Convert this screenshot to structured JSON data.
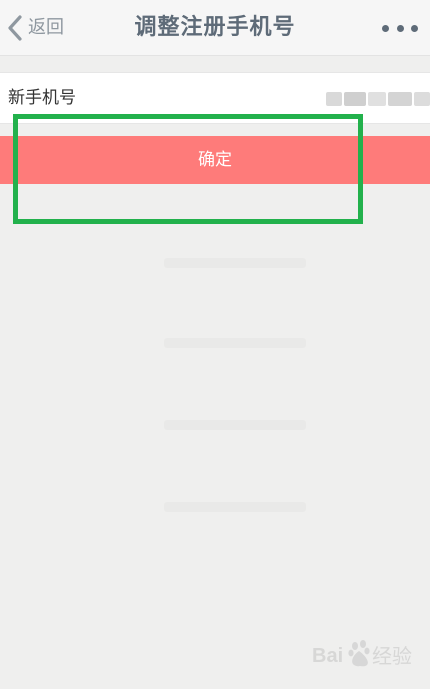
{
  "nav": {
    "back_label": "返回",
    "title": "调整注册手机号",
    "back_icon": "chevron-left-icon",
    "more_icon": "more-horizontal-icon"
  },
  "form": {
    "new_phone_label": "新手机号",
    "new_phone_value_obscured": true
  },
  "confirm_label": "确定",
  "watermark": {
    "text": "Bai经验",
    "brand": "Baidu"
  },
  "colors": {
    "nav_bg": "#f6f6f6",
    "nav_text": "#5e6b78",
    "page_bg": "#efefee",
    "confirm_bg": "#fe7b7a",
    "highlight": "#22b14c"
  }
}
